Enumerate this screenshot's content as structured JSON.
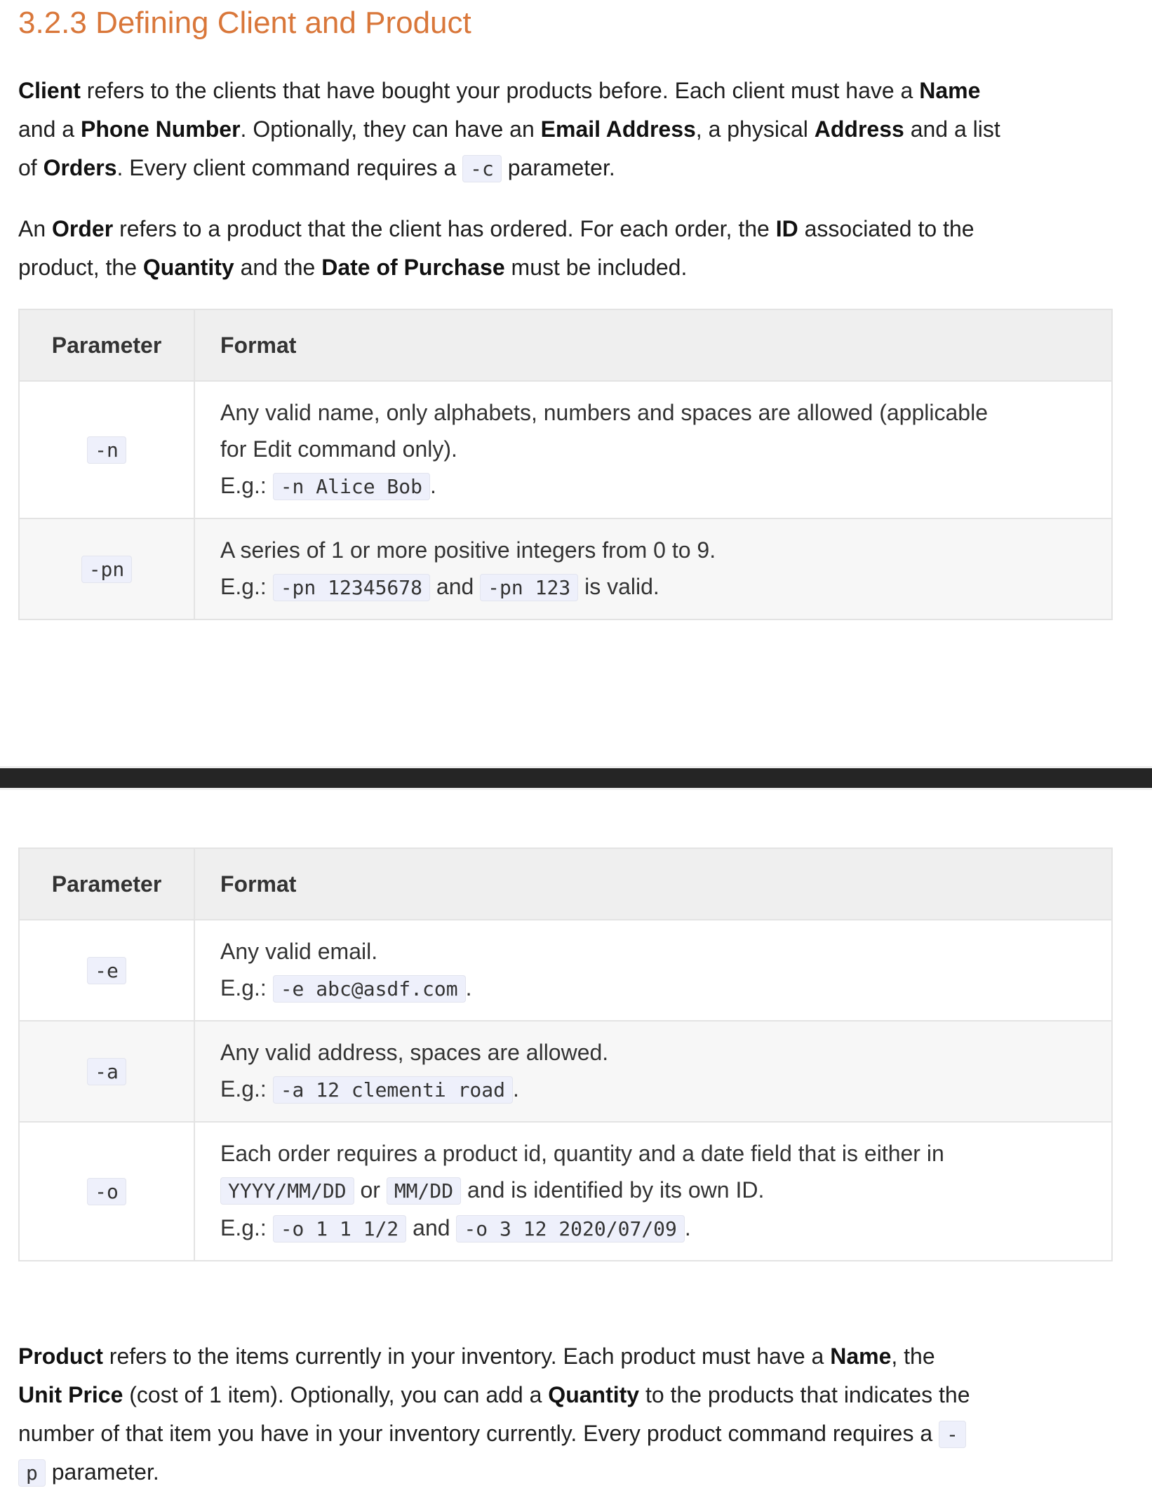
{
  "heading": "3.2.3 Defining Client and Product",
  "client_paragraph": [
    [
      {
        "t": "Client",
        "s": "b"
      },
      {
        "t": " refers to the clients that have bought your products before. Each client must have a "
      },
      {
        "t": "Name",
        "s": "b"
      }
    ],
    [
      {
        "t": "and a "
      },
      {
        "t": "Phone Number",
        "s": "b"
      },
      {
        "t": ". Optionally, they can have an "
      },
      {
        "t": "Email Address",
        "s": "b"
      },
      {
        "t": ", a physical "
      },
      {
        "t": "Address",
        "s": "b"
      },
      {
        "t": " and a list"
      }
    ],
    [
      {
        "t": "of "
      },
      {
        "t": "Orders",
        "s": "b"
      },
      {
        "t": ". Every client command requires a "
      },
      {
        "t": "-c",
        "s": "code"
      },
      {
        "t": " parameter."
      }
    ]
  ],
  "order_paragraph": [
    [
      {
        "t": "An "
      },
      {
        "t": "Order",
        "s": "b"
      },
      {
        "t": " refers to a product that the client has ordered. For each order, the "
      },
      {
        "t": "ID",
        "s": "b"
      },
      {
        "t": " associated to the"
      }
    ],
    [
      {
        "t": "product, the "
      },
      {
        "t": "Quantity",
        "s": "b"
      },
      {
        "t": " and the "
      },
      {
        "t": "Date of Purchase",
        "s": "b"
      },
      {
        "t": " must be included."
      }
    ]
  ],
  "table_headers": {
    "parameter": "Parameter",
    "format": "Format"
  },
  "table1": [
    {
      "param": "-n",
      "lines": [
        [
          {
            "t": "Any valid name, only alphabets, numbers and spaces are allowed (applicable"
          }
        ],
        [
          {
            "t": "for Edit command only)."
          }
        ],
        [
          {
            "t": "E.g.: "
          },
          {
            "t": "-n Alice Bob",
            "s": "code"
          },
          {
            "t": "."
          }
        ]
      ]
    },
    {
      "param": "-pn",
      "lines": [
        [
          {
            "t": "A series of 1 or more positive integers from 0 to 9."
          }
        ],
        [
          {
            "t": "E.g.: "
          },
          {
            "t": "-pn 12345678",
            "s": "code"
          },
          {
            "t": " and "
          },
          {
            "t": "-pn 123",
            "s": "code"
          },
          {
            "t": " is valid."
          }
        ]
      ]
    }
  ],
  "table2": [
    {
      "param": "-e",
      "lines": [
        [
          {
            "t": "Any valid email."
          }
        ],
        [
          {
            "t": "E.g.: "
          },
          {
            "t": "-e abc@asdf.com",
            "s": "code"
          },
          {
            "t": "."
          }
        ]
      ]
    },
    {
      "param": "-a",
      "lines": [
        [
          {
            "t": "Any valid address, spaces are allowed."
          }
        ],
        [
          {
            "t": "E.g.: "
          },
          {
            "t": "-a 12 clementi road",
            "s": "code"
          },
          {
            "t": "."
          }
        ]
      ]
    },
    {
      "param": "-o",
      "lines": [
        [
          {
            "t": "Each order requires a product id, quantity and a date field that is either in"
          }
        ],
        [
          {
            "t": "YYYY/MM/DD",
            "s": "code"
          },
          {
            "t": " or "
          },
          {
            "t": "MM/DD",
            "s": "code"
          },
          {
            "t": " and is identified by its own ID."
          }
        ],
        [
          {
            "t": "E.g.: "
          },
          {
            "t": "-o 1 1 1/2",
            "s": "code"
          },
          {
            "t": " and "
          },
          {
            "t": "-o 3 12 2020/07/09",
            "s": "code"
          },
          {
            "t": "."
          }
        ]
      ]
    }
  ],
  "product_paragraph": [
    [
      {
        "t": "Product",
        "s": "b"
      },
      {
        "t": " refers to the items currently in your inventory. Each product must have a "
      },
      {
        "t": "Name",
        "s": "b"
      },
      {
        "t": ", the"
      }
    ],
    [
      {
        "t": "Unit Price",
        "s": "b"
      },
      {
        "t": " (cost of 1 item). Optionally, you can add a "
      },
      {
        "t": "Quantity",
        "s": "b"
      },
      {
        "t": " to the products that indicates the"
      }
    ],
    [
      {
        "t": "number of that item you have in your inventory currently. Every product command requires a "
      },
      {
        "t": "-",
        "s": "code"
      }
    ],
    [
      {
        "t": "p",
        "s": "code"
      },
      {
        "t": " parameter."
      }
    ]
  ]
}
